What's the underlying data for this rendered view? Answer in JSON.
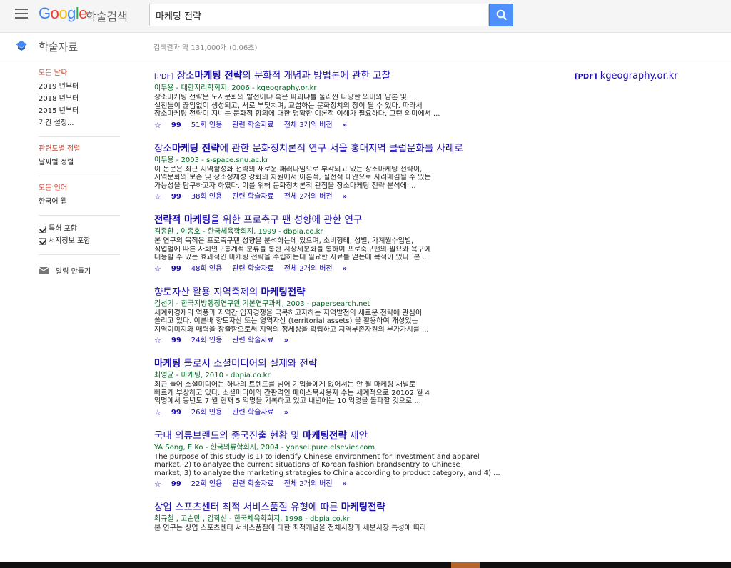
{
  "header": {
    "logo_text": "Google",
    "logo_sub": "학술검색",
    "search_value": "마케팅 전략"
  },
  "subheader": {
    "title": "학술자료",
    "result_count": "검색결과 약 131,000개 (0.06초)"
  },
  "sidebar": {
    "time_head": "모든 날짜",
    "time_items": [
      "2019 년부터",
      "2018 년부터",
      "2015 년부터",
      "기간 설정..."
    ],
    "sort_head": "관련도별 정렬",
    "sort_item": "날짜별 정렬",
    "lang_head": "모든 언어",
    "lang_item": "한국어 웹",
    "checks": [
      "특허 포함",
      "서지정보 포함"
    ],
    "alert": "알림 만들기"
  },
  "side_pdf": {
    "tag": "[PDF]",
    "domain": "kgeography.or.kr"
  },
  "results": [
    {
      "tag": "[PDF]",
      "title_parts": [
        "장소",
        "마케팅 전략",
        "의 문화적 개념과 방법론에 관한 고찰"
      ],
      "meta": "이무용 - 대한지리학회지, 2006 - kgeography.or.kr",
      "snippet": [
        "장소마케팅 전략은 도시문화의 발전이냐 혹은 파괴냐를 둘러싼 다양한 의미와 담론 및",
        "실천들이 끊임없이 생성되고, 서로 부딪치며, 교섭하는 문화정치의 장이 될 수 있다. 따라서",
        "장소마케팅 전략이 지니는 문화적 함의에 대한 명확한 이론적 이해가 필요하다. 그런 의미에서 ..."
      ],
      "cited": "51회 인용",
      "related": "관련 학술자료",
      "versions": "전체 3개의 버전"
    },
    {
      "tag": "",
      "title_parts": [
        "장소",
        "마케팅 전략",
        "에 관한 문화정치론적 연구-서울 홍대지역 클럽문화를 사례로"
      ],
      "meta": "이무용 - 2003 - s-space.snu.ac.kr",
      "snippet": [
        "이 논문은 최근 지역활성화 전략의 새로운 패러다임으로 부각되고 있는 장소마케팅 전략이,",
        "지역문화의 보존 및 장소정체성 강화의 차원에서 이론적, 실천적 대안으로 자리매김될 수 있는",
        "가능성을 탐구하고자 하였다. 이를 위해 문화정치론적 관점을 장소마케팅 전략 분석에 ..."
      ],
      "cited": "38회 인용",
      "related": "관련 학술자료",
      "versions": "전체 2개의 버전"
    },
    {
      "tag": "",
      "title_parts": [
        "",
        "전략적 마케팅",
        "을 위한 프로축구 팬 성향에 관한 연구"
      ],
      "meta": "김종환 , 이종호 - 한국체육학회지, 1999 - dbpia.co.kr",
      "snippet": [
        "본 연구의 목적은 프로축구팬 성향을 분석하는데 있으며, 소비형태, 성별, 가계월수입별,",
        "직업별에 따른 사회인구통계적 분류를 통한 시장세분화를 통하여 프로축구팬의 필요와 욕구에",
        "대응할 수 있는 효과적인 마케팅 전략을 수립하는데 필요한 자료를 얻는데 목적이 있다. 본 ..."
      ],
      "cited": "48회 인용",
      "related": "관련 학술자료",
      "versions": "전체 2개의 버전"
    },
    {
      "tag": "",
      "title_parts": [
        "향토자산 활용 지역축제의 ",
        "마케팅전략",
        ""
      ],
      "meta": "김선기 - 한국지방행정연구원 기본연구과제, 2003 - papersearch.net",
      "snippet": [
        "세계화경제의 역풍과 지역간 입지경쟁을 극복하고자하는 지역발전의 새로운 전략에 관심이",
        "쏠리고 있다. 이른바 향토자산 또는 영역자산 (territorial assets) 을 활용하여 개성있는",
        "지역이미지와 매력을 창출함으로써 지역의 정체성을 확립하고 지역부존자원의 부가가치를 ..."
      ],
      "cited": "24회 인용",
      "related": "관련 학술자료",
      "versions": ""
    },
    {
      "tag": "",
      "title_parts": [
        "",
        "마케팅",
        " 툴로서 소셜미디어의 실제와 전략"
      ],
      "meta": "최영균 - 마케팅, 2010 - dbpia.co.kr",
      "snippet": [
        "최근 들어 소셜미디어는 하나의 트렌드를 넘어 기업들에게 없어서는 안 될 마케팅 채널로",
        "빠르게 부상하고 있다. 소셜미디어의 간판격인 페이스북사용자 수는 세계적으로 20102 월 4",
        "억명에서 동년도 7 월 현재 5 억명을 기록하고 있고 내년에는 10 억명을 돌파할 것으로 ..."
      ],
      "cited": "26회 인용",
      "related": "관련 학술자료",
      "versions": ""
    },
    {
      "tag": "",
      "title_parts": [
        "국내 의류브랜드의 중국진출 현황 및 ",
        "마케팅전략",
        " 제안"
      ],
      "meta": "YA Song, E Ko - 한국의류학회지, 2004 - yonsei.pure.elsevier.com",
      "snippet": [
        "The purpose of this study is 1) to identify Chinese environment for investment and apparel",
        "market, 2) to analyze the current situations of Korean fashion brandsentry to Chinese",
        "market, 3) to analyze the marketing strategies to China according to product category, and 4) ..."
      ],
      "cited": "22회 인용",
      "related": "관련 학술자료",
      "versions": "전체 2개의 버전"
    },
    {
      "tag": "",
      "title_parts": [
        "상업 스포츠센터 최적 서비스품질 유형에 따른 ",
        "마케팅전략",
        ""
      ],
      "meta": "최규철 , 고순만 , 김학신 - 한국체육학회지, 1998 - dbpia.co.kr",
      "snippet": [
        "본 연구는 상업 스포츠센터 서비스품질에 대한 최적개념을 전체시장과 세분시장 특성에 따라"
      ],
      "cited": "",
      "related": "",
      "versions": ""
    }
  ]
}
